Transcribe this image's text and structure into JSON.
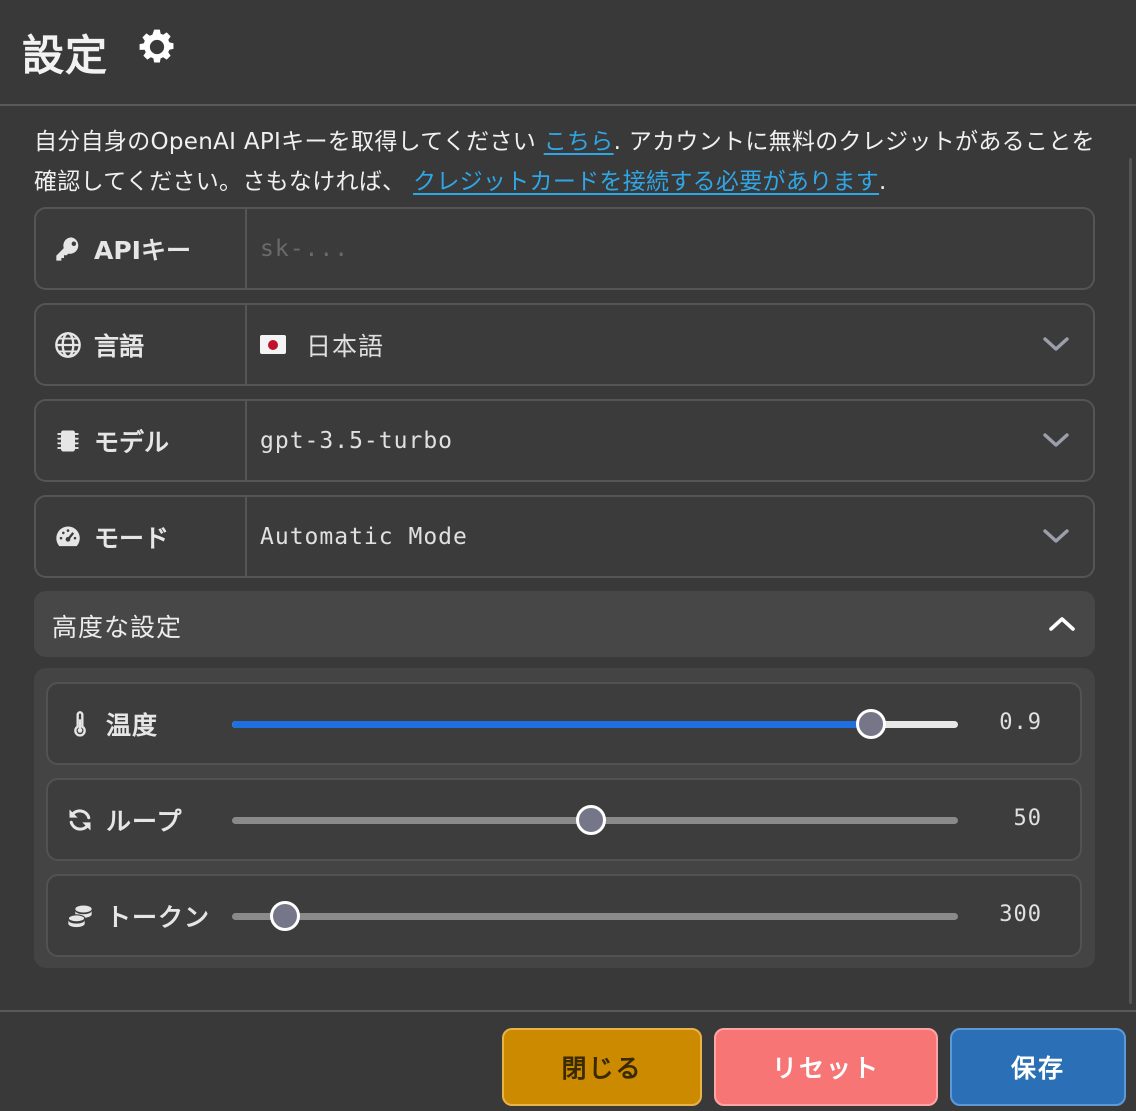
{
  "header": {
    "title": "設定"
  },
  "intro": {
    "text1": "自分自身のOpenAI APIキーを取得してください ",
    "link1": "こちら",
    "text2": ". アカウントに無料のクレジットがあることを確認してください。さもなければ、 ",
    "link2": "クレジットカードを接続する必要があります",
    "text3": "."
  },
  "fields": {
    "api_key": {
      "label": "APIキー",
      "placeholder": "sk-..."
    },
    "language": {
      "label": "言語",
      "value": "日本語"
    },
    "model": {
      "label": "モデル",
      "value": "gpt-3.5-turbo"
    },
    "mode": {
      "label": "モード",
      "value": "Automatic Mode"
    }
  },
  "advanced": {
    "title": "高度な設定",
    "sliders": [
      {
        "label": "温度",
        "value": "0.9",
        "fraction": 0.88,
        "icon": "thermometer-icon"
      },
      {
        "label": "ループ",
        "value": "50",
        "fraction": 0.495,
        "icon": "refresh-icon"
      },
      {
        "label": "トークン",
        "value": "300",
        "fraction": 0.073,
        "icon": "coins-icon"
      }
    ]
  },
  "footer": {
    "close": "閉じる",
    "reset": "リセット",
    "save": "保存"
  },
  "colors": {
    "accent_blue": "#1f6fe0",
    "link": "#2fa6e6",
    "close_btn": "#cc8a00",
    "reset_btn": "#f77575",
    "save_btn": "#2b6fb6"
  }
}
